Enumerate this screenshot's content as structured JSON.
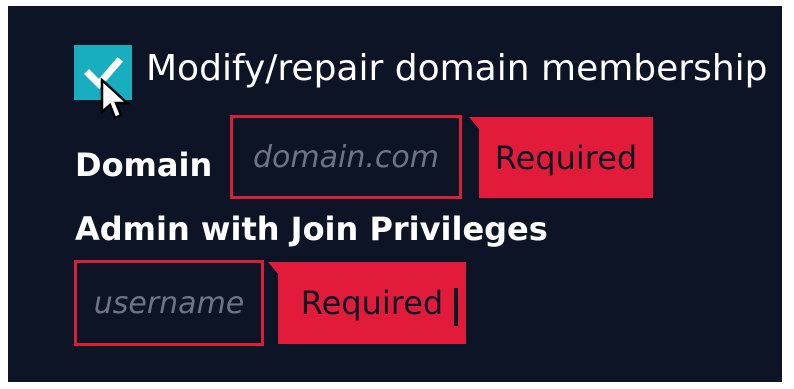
{
  "membership": {
    "checkbox_checked": true,
    "checkbox_label": "Modify/repair domain membership",
    "checkbox_color": "#19adc0"
  },
  "domain": {
    "label": "Domain",
    "placeholder": "domain.com",
    "value": "",
    "validation": "Required"
  },
  "admin": {
    "label": "Admin with Join Privileges",
    "placeholder": "username",
    "value": "",
    "validation": "Required"
  },
  "colors": {
    "background": "#0d1426",
    "error": "#e31b3b",
    "accent": "#19adc0"
  },
  "icons": {
    "checkmark": "checkmark-icon",
    "cursor": "mouse-pointer-icon"
  }
}
